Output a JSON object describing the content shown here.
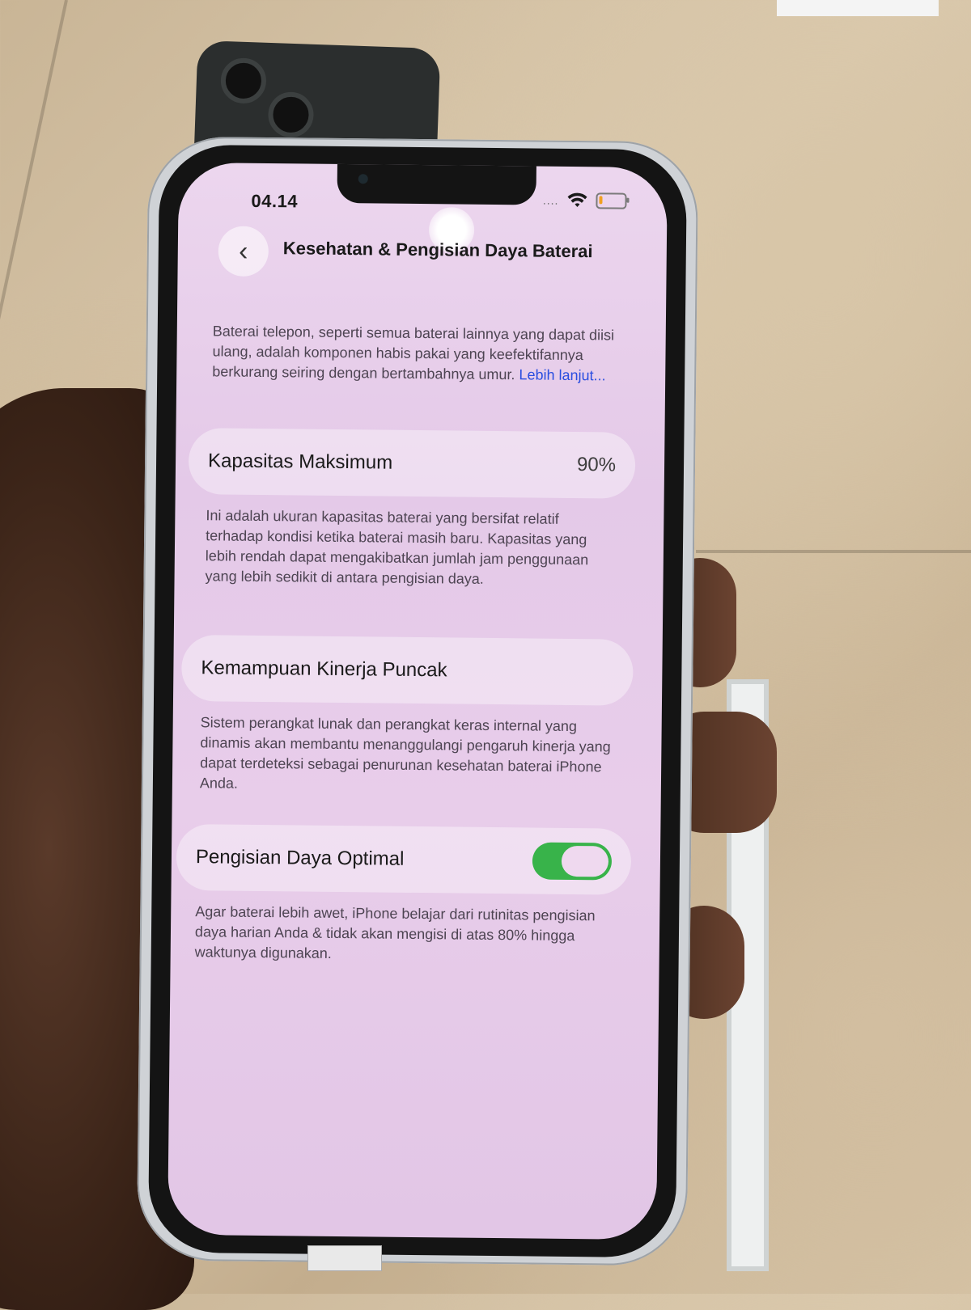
{
  "status_bar": {
    "time": "04.14",
    "signal_dots": "....",
    "wifi_icon": "wifi-icon",
    "battery_icon": "battery-low-icon",
    "battery_fill_fraction": 0.12,
    "battery_color": "#f0a020"
  },
  "nav": {
    "back_icon": "chevron-left-icon",
    "back_glyph": "‹",
    "title": "Kesehatan & Pengisian Daya Baterai"
  },
  "intro": {
    "text": "Baterai telepon, seperti semua baterai lainnya yang dapat diisi ulang, adalah komponen habis pakai yang keefektifannya berkurang seiring dengan bertambahnya umur.",
    "link": "Lebih lanjut..."
  },
  "max_capacity": {
    "label": "Kapasitas Maksimum",
    "value": "90%",
    "description": "Ini adalah ukuran kapasitas baterai yang bersifat relatif terhadap kondisi ketika baterai masih baru. Kapasitas yang lebih rendah dapat mengakibatkan jumlah jam penggunaan yang lebih sedikit di antara pengisian daya."
  },
  "peak_performance": {
    "label": "Kemampuan Kinerja Puncak",
    "description": "Sistem perangkat lunak dan perangkat keras internal yang dinamis akan membantu menanggulangi pengaruh kinerja yang dapat terdeteksi sebagai penurunan kesehatan baterai iPhone Anda."
  },
  "optimized_charging": {
    "label": "Pengisian Daya Optimal",
    "enabled": true,
    "toggle_color": "#38b34a",
    "description": "Agar baterai lebih awet, iPhone belajar dari rutinitas pengisian daya harian Anda & tidak akan mengisi di atas 80% hingga waktunya digunakan."
  }
}
